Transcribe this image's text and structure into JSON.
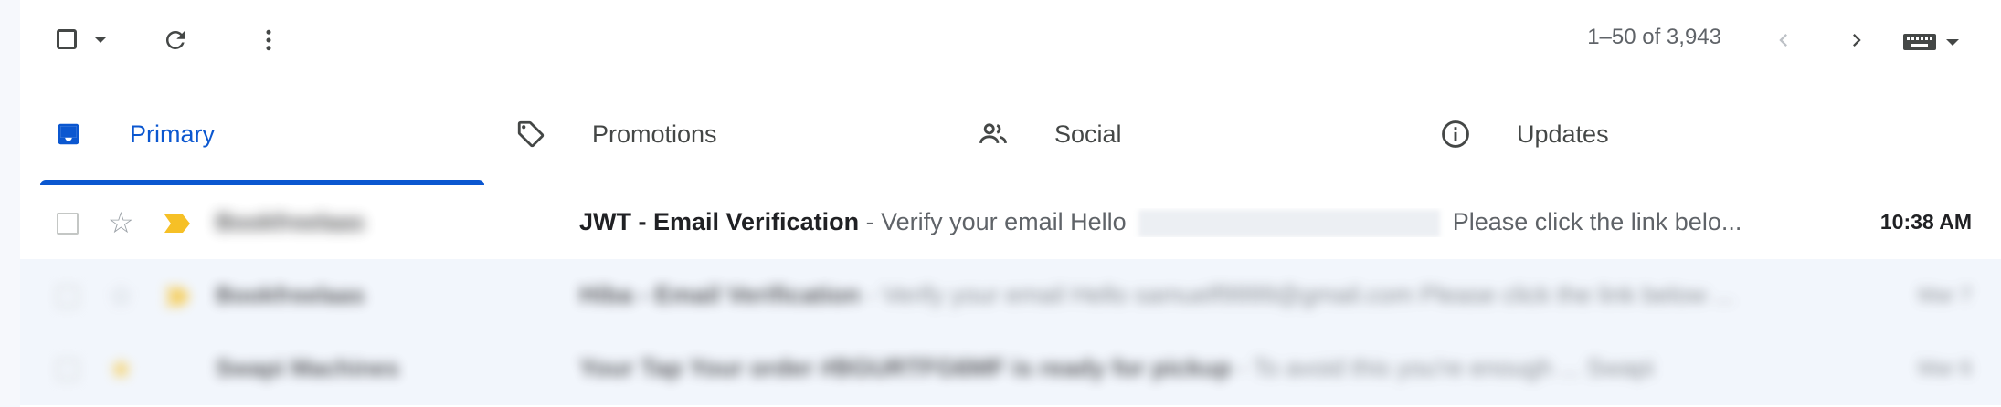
{
  "toolbar": {
    "select_all_icon": "checkbox-empty",
    "select_menu_icon": "caret-down",
    "refresh_icon": "refresh",
    "more_icon": "more-vert",
    "pagination": "1–50 of 3,943",
    "prev_icon": "chevron-left",
    "next_icon": "chevron-right",
    "input_tools_icon": "keyboard"
  },
  "tabs": [
    {
      "label": "Primary",
      "icon": "inbox",
      "active": true
    },
    {
      "label": "Promotions",
      "icon": "tag",
      "active": false
    },
    {
      "label": "Social",
      "icon": "people",
      "active": false
    },
    {
      "label": "Updates",
      "icon": "info",
      "active": false
    }
  ],
  "emails": [
    {
      "sender": "Bookfreelaas",
      "subject": "JWT - Email Verification",
      "snippet_before": " - Verify your email Hello ",
      "snippet_after": " Please click the link belo...",
      "time": "10:38 AM",
      "starred": false,
      "important": true
    },
    {
      "sender": "Bookfreelaas",
      "subject": "Hiba - Email Verification",
      "snippet": " - Verify your email Hello samuelf9999@gmail.com Please click the link below ...",
      "time": "Mar 7",
      "starred": false,
      "important": true
    },
    {
      "sender": "Swapi Machines",
      "subject": "Your Tap Your order #BGURTFG6MF is ready for pickup",
      "snippet": " - To avoid this you're enough ... Swapi",
      "time": "Mar 6",
      "starred": true,
      "important": false
    }
  ],
  "colors": {
    "accent": "#0b57d0",
    "important": "#f6c026",
    "background": "#f6f8fc"
  }
}
